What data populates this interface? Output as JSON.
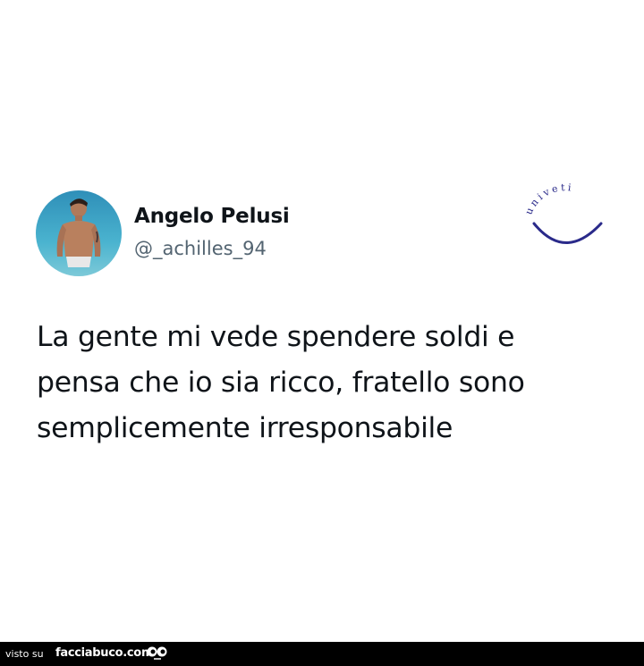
{
  "tweet": {
    "author_name": "Angelo Pelusi",
    "author_handle": "@_achilles_94",
    "avatar": "profile-photo",
    "text_lines": [
      "La gente mi vede spendere soldi e",
      "pensa che io sia ricco, fratello sono",
      "semplicemente irresponsabile"
    ]
  },
  "watermark": {
    "text": "univeti",
    "color": "#2a2a8a"
  },
  "footer": {
    "label": "visto su",
    "site": "facciabuco.com",
    "icon": "eyes-icon",
    "background": "#000000"
  },
  "colors": {
    "text_primary": "#0f1419",
    "text_secondary": "#536471",
    "background": "#ffffff"
  }
}
